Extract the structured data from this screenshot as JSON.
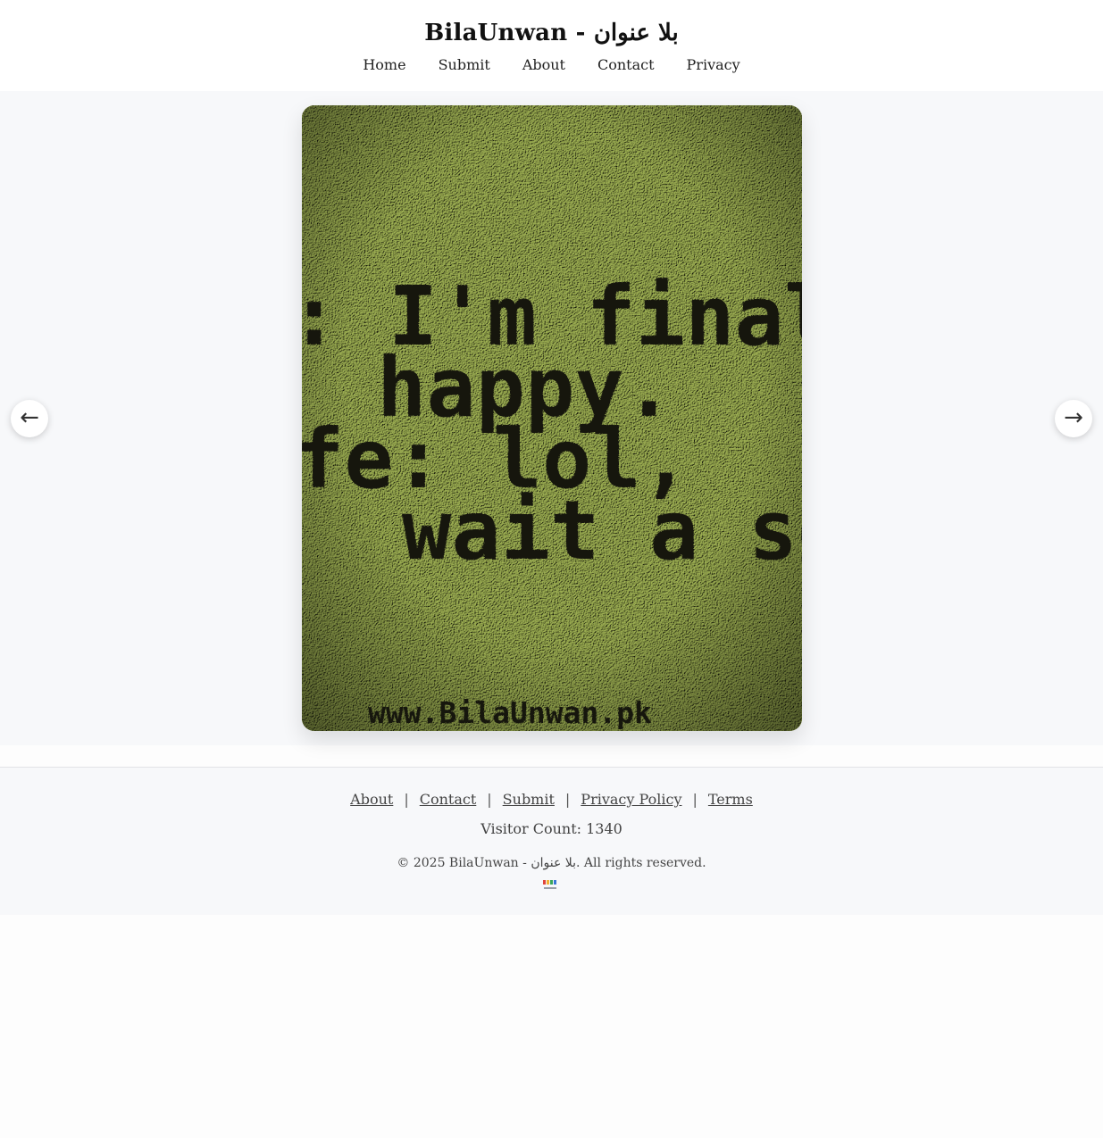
{
  "header": {
    "title": "BilaUnwan - بلا عنوان",
    "nav": [
      {
        "label": "Home"
      },
      {
        "label": "Submit"
      },
      {
        "label": "About"
      },
      {
        "label": "Contact"
      },
      {
        "label": "Privacy"
      }
    ]
  },
  "gallery": {
    "image_text_lines": [
      ": I'm finall",
      "happy.",
      "fe: lol,",
      "wait a se"
    ],
    "watermark": "www.BilaUnwan.pk",
    "image_bg_color": "#9fae5e",
    "prev_icon": "←",
    "next_icon": "→"
  },
  "footer": {
    "links": [
      {
        "label": "About"
      },
      {
        "label": "Contact"
      },
      {
        "label": "Submit"
      },
      {
        "label": "Privacy Policy"
      },
      {
        "label": "Terms"
      }
    ],
    "separator": "|",
    "visitor_count": "Visitor Count: 1340",
    "copyright": "© 2025 BilaUnwan - بلا عنوان. All rights reserved."
  }
}
